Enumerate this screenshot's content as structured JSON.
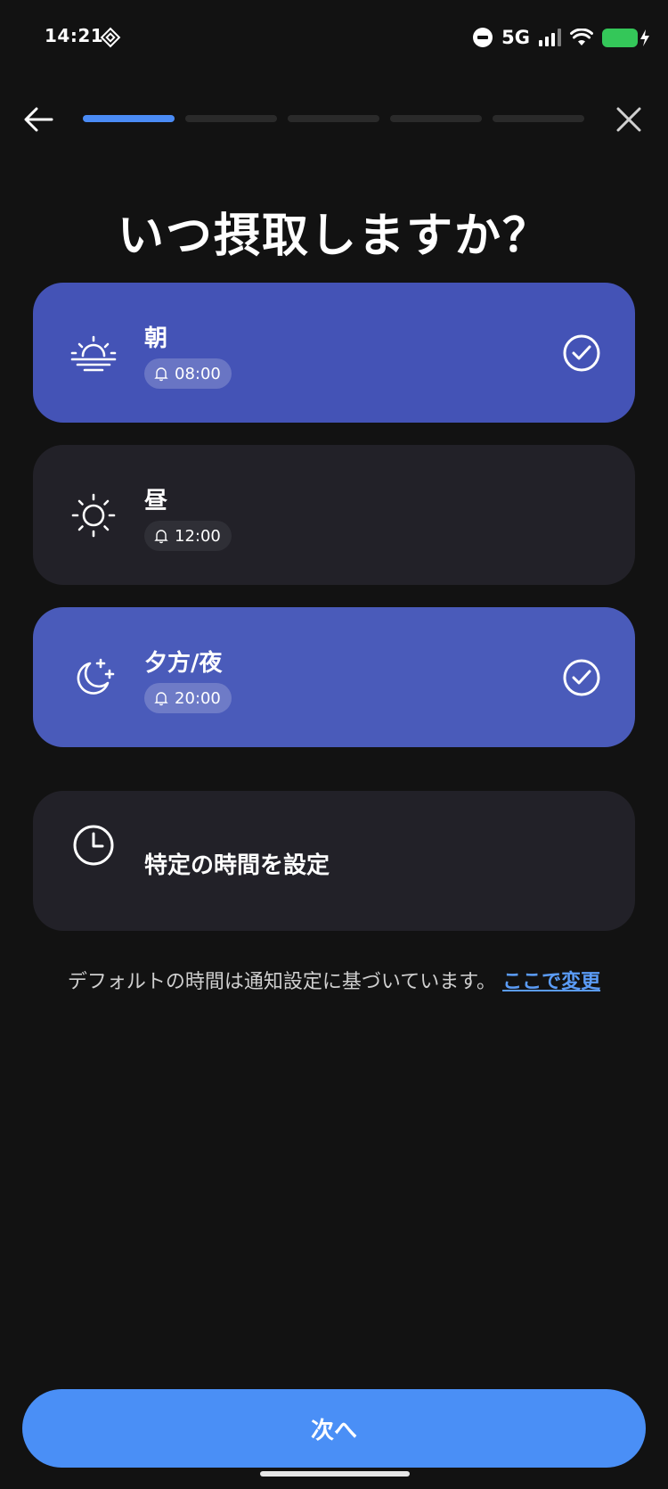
{
  "status": {
    "time": "14:21",
    "network": "5G"
  },
  "nav": {
    "progress_total_steps": 5,
    "progress_current_step": 1
  },
  "title": "いつ摂取しますか？",
  "options": [
    {
      "label": "朝",
      "time": "08:00",
      "selected": true,
      "icon": "sunrise-icon"
    },
    {
      "label": "昼",
      "time": "12:00",
      "selected": false,
      "icon": "sun-icon"
    },
    {
      "label": "夕方/夜",
      "time": "20:00",
      "selected": true,
      "icon": "moon-stars-icon"
    },
    {
      "label": "特定の時間を設定",
      "selected": false,
      "icon": "clock-icon"
    }
  ],
  "note": {
    "text": "デフォルトの時間は通知設定に基づいています。",
    "link": "ここで変更"
  },
  "next_button": "次へ",
  "colors": {
    "accent": "#4a8ff6",
    "selected_card": "#4453b6",
    "card": "#222128",
    "background": "#121212"
  }
}
